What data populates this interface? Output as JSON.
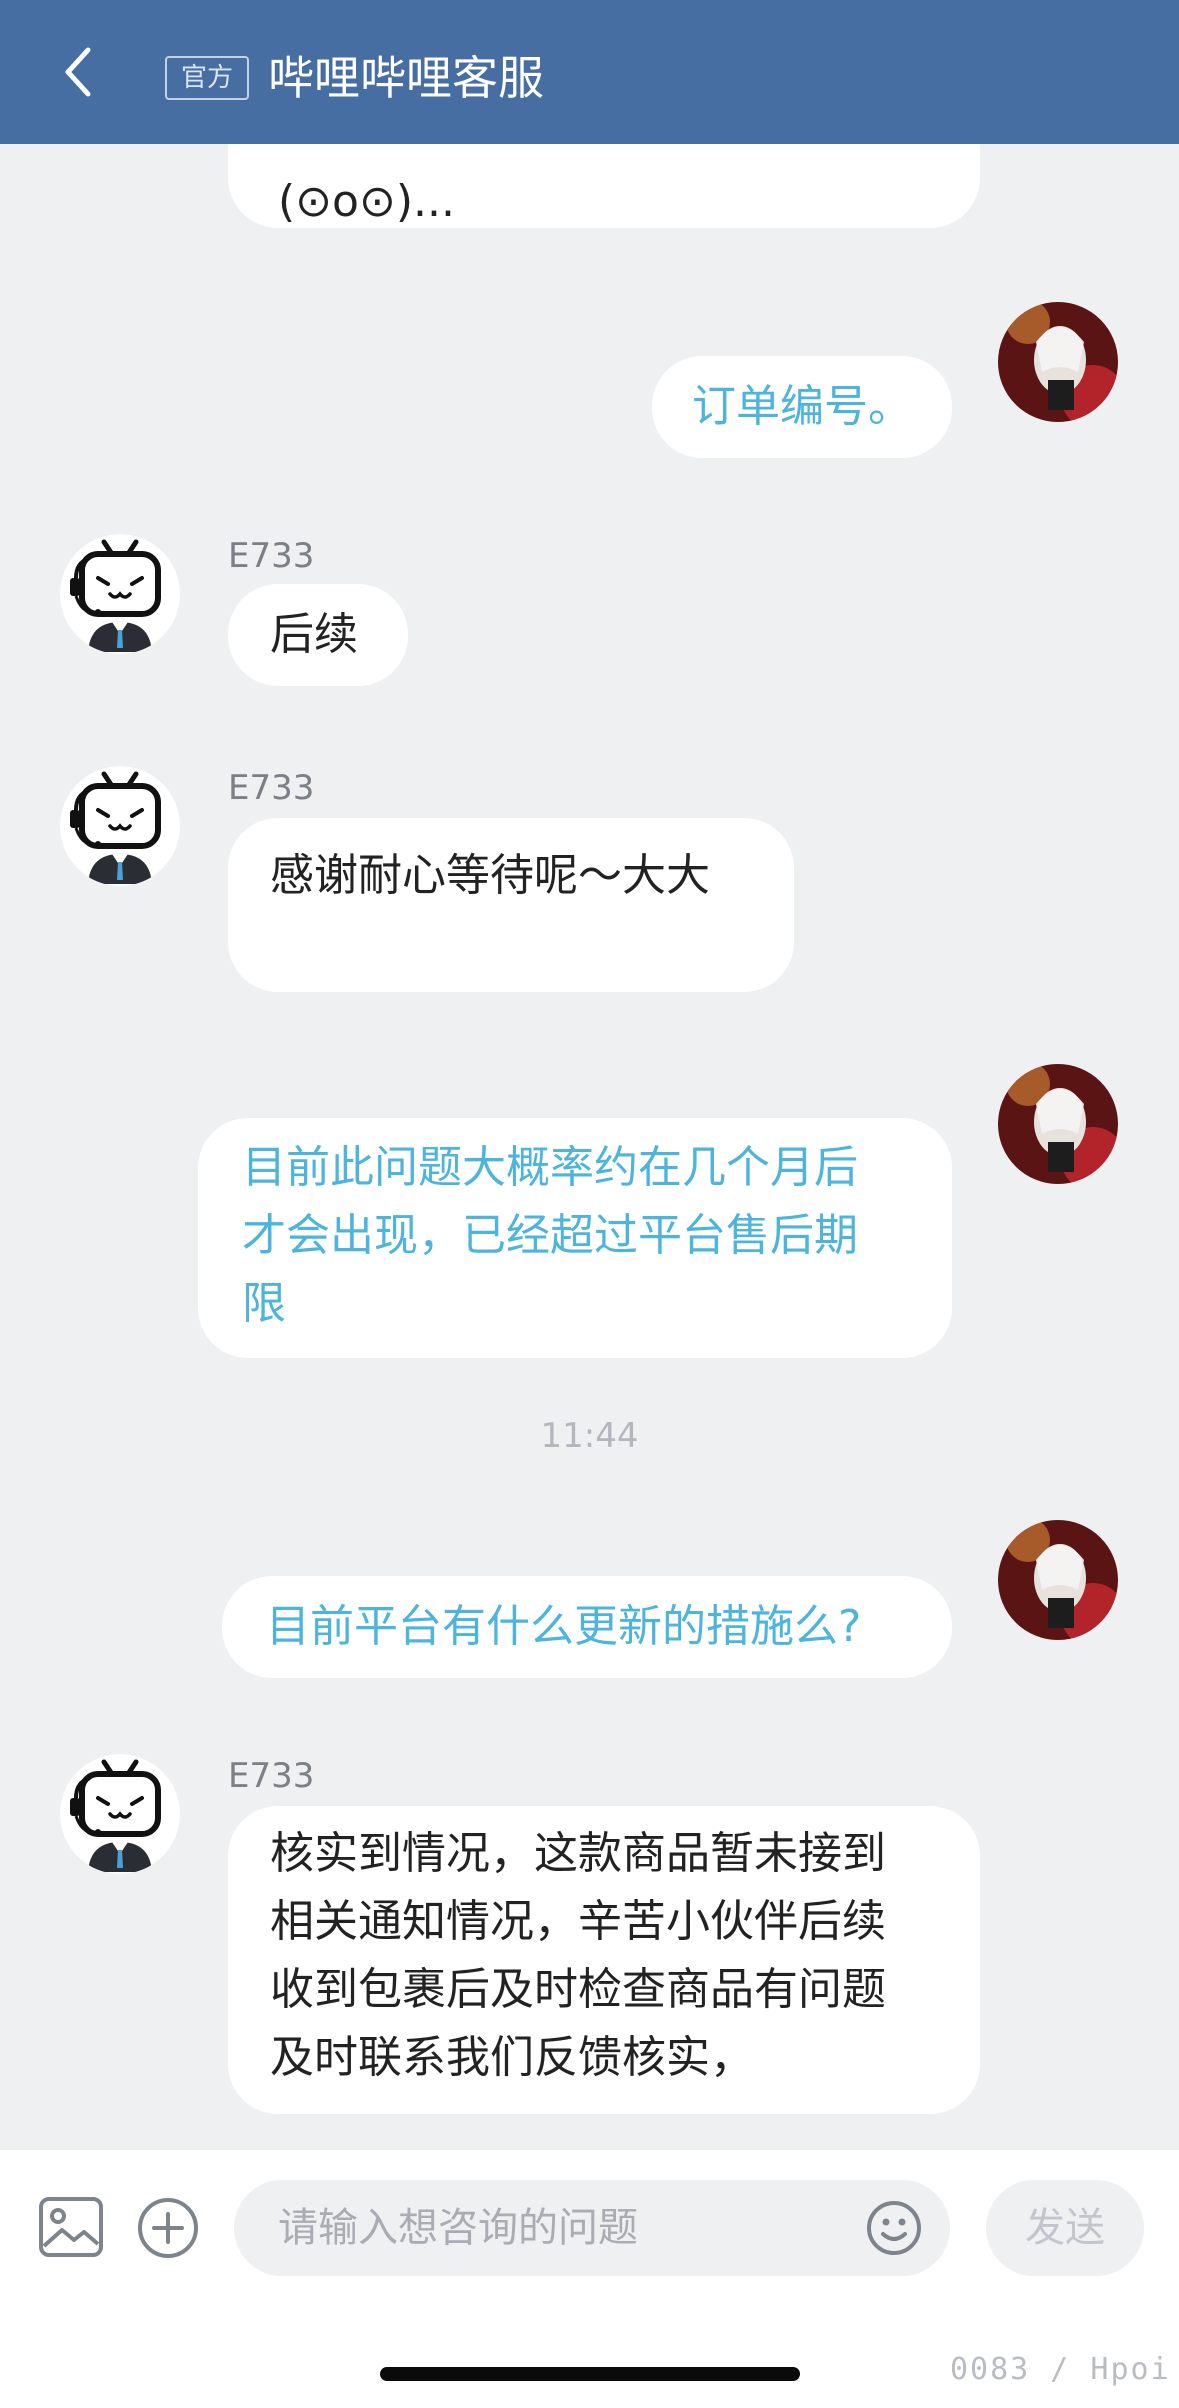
{
  "header": {
    "back_icon": "chevron-left-icon",
    "official_tag": "官方",
    "title": "哔哩哔哩客服"
  },
  "messages": [
    {
      "side": "in",
      "text": "(⊙o⊙)..."
    },
    {
      "side": "out",
      "text": "订单编号。"
    },
    {
      "side": "in",
      "sender": "E733",
      "text": "后续"
    },
    {
      "side": "in",
      "sender": "E733",
      "text": "感谢耐心等待呢～大大"
    },
    {
      "side": "out",
      "text_lines": [
        "目前此问题大概率约在几个月后",
        "才会出现，已经超过平台售后期",
        "限"
      ]
    },
    {
      "timestamp": "11:44"
    },
    {
      "side": "out",
      "text": "目前平台有什么更新的措施么?"
    },
    {
      "side": "in",
      "sender": "E733",
      "text_lines": [
        "核实到情况，这款商品暂未接到",
        "相关通知情况，辛苦小伙伴后续",
        "收到包裹后及时检查商品有问题",
        "及时联系我们反馈核实，"
      ]
    }
  ],
  "input_bar": {
    "image_icon": "image-icon",
    "add_icon": "plus-circle-icon",
    "placeholder": "请输入想咨询的问题",
    "emoji_icon": "emoji-icon",
    "send_label": "发送"
  },
  "watermark": "0083 / Hpoi",
  "colors": {
    "header_bg": "#466ea3",
    "outgoing_text": "#4db4dc",
    "incoming_text": "#222222",
    "background": "#eef0f2"
  }
}
